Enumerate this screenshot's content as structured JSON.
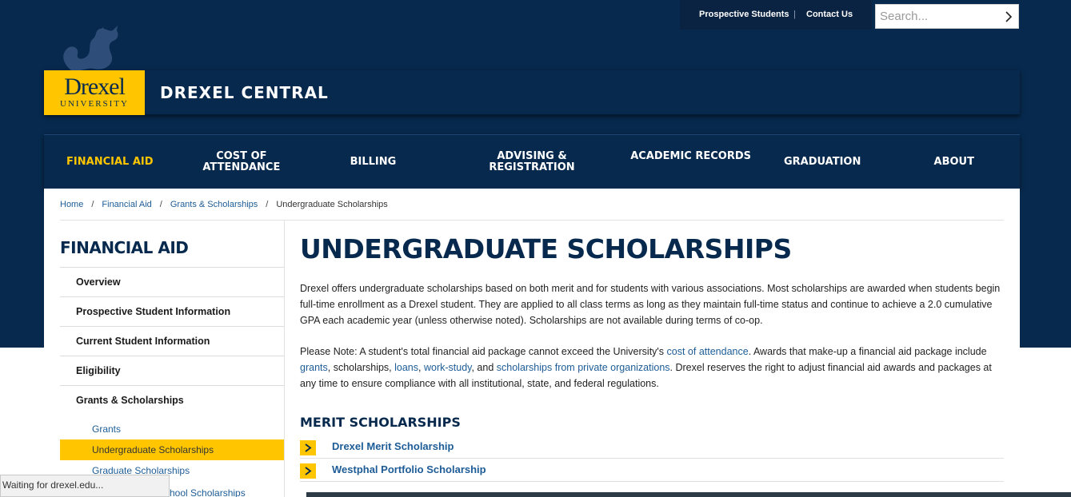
{
  "utility": {
    "prospective_label": "Prospective Students",
    "separator": "|",
    "contact_label": "Contact Us",
    "search_placeholder": "Search..."
  },
  "brand": {
    "logo_word": "Drexel",
    "logo_sub": "UNIVERSITY",
    "site_title": "DREXEL CENTRAL"
  },
  "nav": {
    "items": [
      {
        "label": "FINANCIAL AID",
        "active": true
      },
      {
        "label": "COST OF ATTENDANCE"
      },
      {
        "label": "BILLING"
      },
      {
        "label": "ADVISING & REGISTRATION"
      },
      {
        "label": "ACADEMIC RECORDS"
      },
      {
        "label": "GRADUATION"
      },
      {
        "label": "ABOUT"
      }
    ]
  },
  "breadcrumb": {
    "home": "Home",
    "financial_aid": "Financial Aid",
    "grants": "Grants & Scholarships",
    "current": "Undergraduate Scholarships",
    "sep": "/"
  },
  "sidebar": {
    "title": "FINANCIAL AID",
    "items": [
      "Overview",
      "Prospective Student Information",
      "Current Student Information",
      "Eligibility",
      "Grants & Scholarships"
    ],
    "sub_items": [
      "Grants",
      "Undergraduate Scholarships",
      "Graduate Scholarships"
    ],
    "active_sub": "Undergraduate Scholarships"
  },
  "main": {
    "title": "UNDERGRADUATE SCHOLARSHIPS",
    "para1": "Drexel offers undergraduate scholarships based on both merit and for students with various associations. Most scholarships are awarded when students begin full-time enrollment as a Drexel student. They are applied to all class terms as long as they maintain full-time status and continue to achieve a 2.0 cumulative GPA each academic year (unless otherwise noted). Scholarships are not available during terms of co-op.",
    "para2": {
      "t1": "Please Note: A student's total financial aid package cannot exceed the University's ",
      "l1": "cost of attendance",
      "t2": ". Awards that make-up a financial aid package include ",
      "l2": "grants",
      "t3": ", scholarships, ",
      "l3": "loans",
      "t4": ", ",
      "l4": "work-study",
      "t5": ", and ",
      "l5": "scholarships from private organizations",
      "t6": ". Drexel reserves the right to adjust financial aid awards and packages at any time to ensure compliance with all institutional, state, and federal regulations."
    },
    "section_title": "MERIT SCHOLARSHIPS",
    "accordions": [
      "Drexel Merit Scholarship",
      "Westphal Portfolio Scholarship"
    ]
  },
  "browser": {
    "status": "Waiting for drexel.edu...",
    "cut_text": "hool Scholarships"
  },
  "colors": {
    "navy": "#07294d",
    "gold": "#ffc600",
    "link": "#1d5c96"
  }
}
